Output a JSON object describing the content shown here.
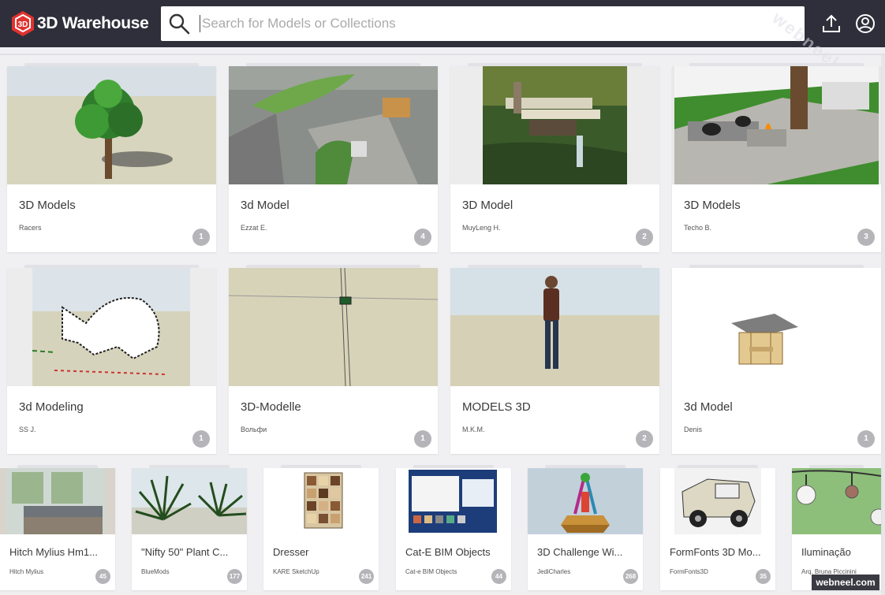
{
  "header": {
    "logo_text": "3D Warehouse",
    "search_placeholder": "Search for Models or Collections",
    "search_value": ""
  },
  "watermark": "webneel.com",
  "watermark_bottom": "webneel.com",
  "colors": {
    "header_bg": "#2f2f3b",
    "accent": "#e0322e",
    "badge": "#b5b5b9"
  },
  "row1": [
    {
      "title": "3D Models",
      "author": "Racers",
      "count": "1"
    },
    {
      "title": "3d Model",
      "author": "Ezzat E.",
      "count": "4"
    },
    {
      "title": "3D Model",
      "author": "MuyLeng H.",
      "count": "2"
    },
    {
      "title": "3D Models",
      "author": "Techo B.",
      "count": "3"
    }
  ],
  "row2": [
    {
      "title": "3d Modeling",
      "author": "SS J.",
      "count": "1"
    },
    {
      "title": "3D-Modelle",
      "author": "Вольфи",
      "count": "1"
    },
    {
      "title": "MODELS 3D",
      "author": "M.K.M.",
      "count": "2"
    },
    {
      "title": "3d Model",
      "author": "Denis",
      "count": "1"
    }
  ],
  "row3": [
    {
      "title": "Hitch Mylius Hm1...",
      "author": "Hitch Mylius",
      "count": "45"
    },
    {
      "title": "\"Nifty 50\" Plant C...",
      "author": "BlueMods",
      "count": "177"
    },
    {
      "title": "Dresser",
      "author": "KARE SketchUp",
      "count": "241"
    },
    {
      "title": "Cat-E BIM Objects",
      "author": "Cat-e BIM Objects",
      "count": "44"
    },
    {
      "title": "3D Challenge Wi...",
      "author": "JediCharles",
      "count": "268"
    },
    {
      "title": "FormFonts 3D Mo...",
      "author": "FormFonts3D",
      "count": "35"
    },
    {
      "title": "Iluminação",
      "author": "Arq. Bruna Piccinini",
      "count": ""
    }
  ]
}
